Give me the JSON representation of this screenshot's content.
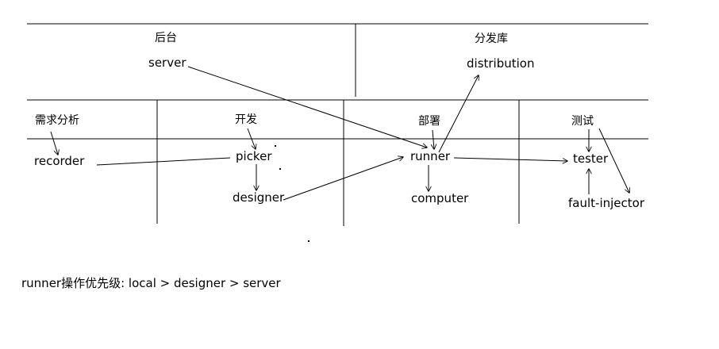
{
  "top_sections": {
    "backend": {
      "title": "后台",
      "item": "server"
    },
    "repo": {
      "title": "分发库",
      "item": "distribution"
    }
  },
  "stages": {
    "requirements": {
      "title": "需求分析",
      "item": "recorder"
    },
    "develop": {
      "title": "开发",
      "items": [
        "picker",
        "designer"
      ]
    },
    "deploy": {
      "title": "部署",
      "items": [
        "runner",
        "computer"
      ]
    },
    "test": {
      "title": "测试",
      "items": [
        "tester",
        "fault-injector"
      ]
    }
  },
  "note": "runner操作优先级: local > designer > server",
  "colors": {
    "line": "#000000",
    "background": "#ffffff"
  }
}
